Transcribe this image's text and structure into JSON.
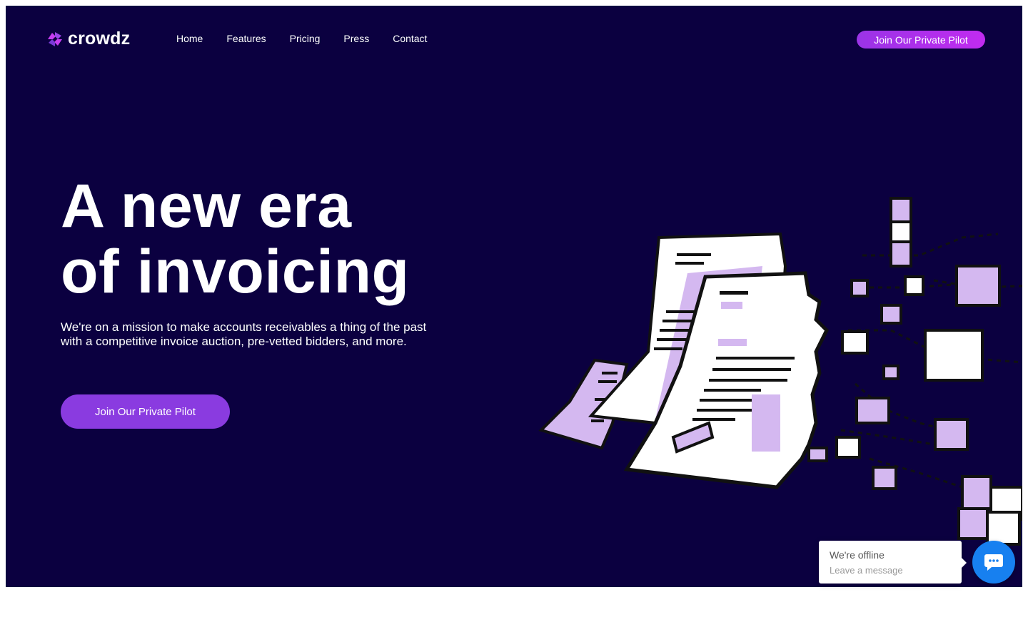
{
  "brand": {
    "name": "crowdz",
    "logo_icon": "crowdz-logo-icon",
    "accent": "#8a3be0",
    "background": "#0b0040"
  },
  "nav": {
    "links": [
      "Home",
      "Features",
      "Pricing",
      "Press",
      "Contact"
    ],
    "cta_label": "Join Our Private Pilot"
  },
  "hero": {
    "headline_line1": "A new era",
    "headline_line2": "of invoicing",
    "subtext": "We're on a mission to make accounts receivables a thing of the past with a competitive invoice auction, pre-vetted bidders, and more.",
    "cta_label": "Join Our Private Pilot",
    "illustration_icon": "invoice-blocks-illustration"
  },
  "chat": {
    "title": "We're offline",
    "subtitle": "Leave a message",
    "icon": "chat-icon",
    "button_color": "#1780f0"
  }
}
